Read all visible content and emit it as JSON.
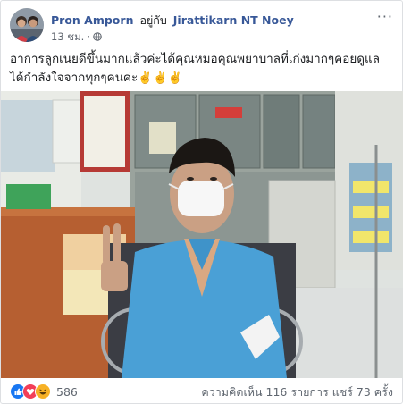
{
  "post": {
    "author": "Pron Amporn",
    "with_text": "อยู่กับ",
    "tagged_user": "Jirattikarn NT Noey",
    "time": "13 ชม.",
    "dot": "·",
    "more_label": "···",
    "text_line1": "อาการลูกเนยดีขึ้นมากแล้วค่ะได้คุณหมอคุณพยาบาลที่เก่งมากๆคอยดูแล",
    "text_line2": "ได้กำลังใจจากทุกๆคนค่ะ✌️✌️✌️"
  },
  "footer": {
    "reaction_count": "586",
    "comments": "ความคิดเห็น 116 รายการ",
    "shares": "แชร์ 73 ครั้ง"
  },
  "colors": {
    "link": "#385898",
    "like": "#1877f2",
    "love": "#f33e58",
    "haha": "#f7b125"
  },
  "icons": [
    "globe-icon",
    "like-reaction-icon",
    "love-reaction-icon",
    "haha-reaction-icon",
    "more-options-icon"
  ]
}
